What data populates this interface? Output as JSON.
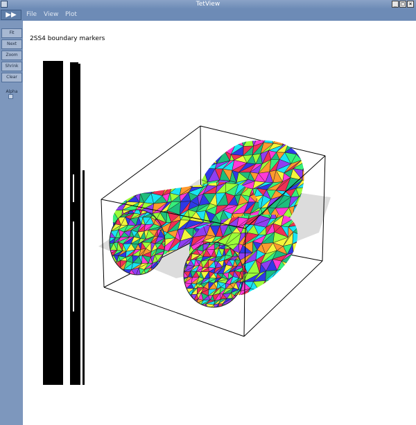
{
  "window": {
    "title": "TetView"
  },
  "menu": {
    "items": [
      "File",
      "View",
      "Plot"
    ],
    "run_icon": "play-icon"
  },
  "toolbar": {
    "buttons": [
      "Fit",
      "Next",
      "Zoom",
      "Shrink",
      "Clear"
    ],
    "slider_label": "Alpha"
  },
  "canvas": {
    "caption": "2SS4 boundary markers"
  },
  "colors": {
    "titlebar": "#7a97c0",
    "toolbar": "#7d97bd",
    "mesh_palette": [
      "#ff3ad6",
      "#19e3f2",
      "#f3f63b",
      "#2f39e6",
      "#36f07a",
      "#ef2f55",
      "#8f3ef2",
      "#1dbd7d",
      "#9bff3a",
      "#ff9a2e"
    ]
  }
}
